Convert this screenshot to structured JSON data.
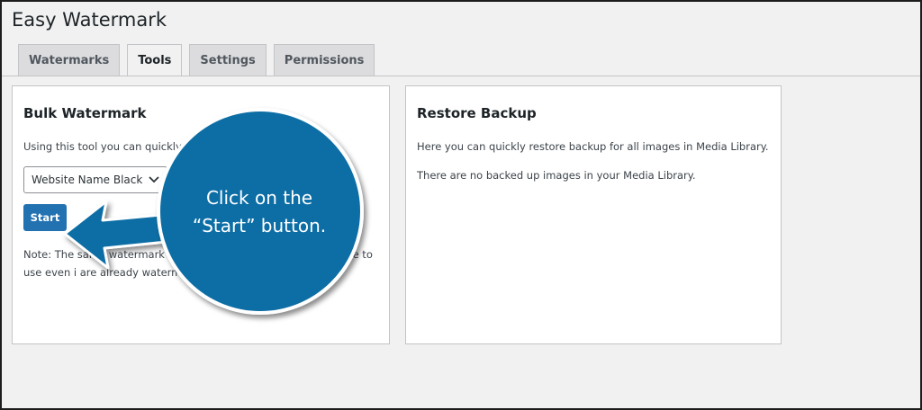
{
  "page": {
    "title": "Easy Watermark"
  },
  "tabs": [
    {
      "label": "Watermarks",
      "active": false
    },
    {
      "label": "Tools",
      "active": true
    },
    {
      "label": "Settings",
      "active": false
    },
    {
      "label": "Permissions",
      "active": false
    }
  ],
  "bulk": {
    "title": "Bulk Watermark",
    "description": "Using this tool you can quickly a s in the Media Library.",
    "select_value": "Website Name Black",
    "start_label": "Start",
    "note": "Note: The same watermark will b e same image. This tool is safe to use even i are already watermarked."
  },
  "restore": {
    "title": "Restore Backup",
    "line1": "Here you can quickly restore backup for all images in Media Library.",
    "line2": "There are no backed up images in your Media Library."
  },
  "callout": {
    "line1": "Click on the",
    "line2": "“Start” button.",
    "color": "#0a6ea5"
  },
  "icons": {
    "select_arrow": "chevron-down-icon"
  }
}
